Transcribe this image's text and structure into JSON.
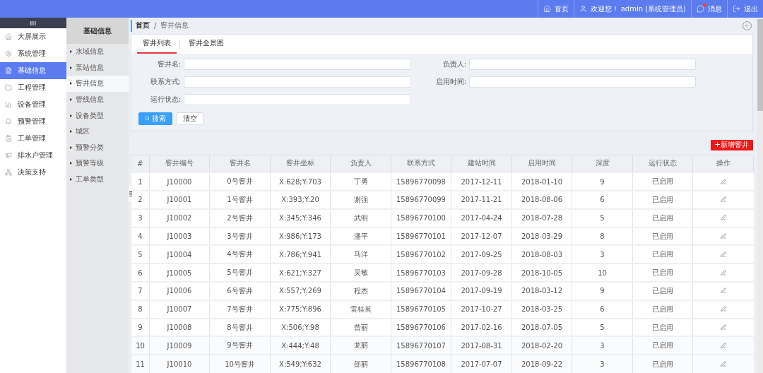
{
  "top_bar": {
    "links": [
      {
        "kind": "home",
        "label": "首页"
      },
      {
        "kind": "user",
        "label": "欢迎您！ admin (系统管理员)"
      },
      {
        "kind": "message",
        "label": "消息",
        "unread": true
      },
      {
        "kind": "logout",
        "label": "退出"
      }
    ]
  },
  "sidebar": {
    "items": [
      {
        "label": "大屏展示",
        "selected": false
      },
      {
        "label": "系统管理",
        "selected": false
      },
      {
        "label": "基础信息",
        "selected": true
      },
      {
        "label": "工程管理",
        "selected": false
      },
      {
        "label": "设备管理",
        "selected": false
      },
      {
        "label": "预警管理",
        "selected": false
      },
      {
        "label": "工单管理",
        "selected": false
      },
      {
        "label": "排水户管理",
        "selected": false
      },
      {
        "label": "决策支持",
        "selected": false
      }
    ]
  },
  "submenu": {
    "title": "基础信息",
    "items": [
      {
        "label": "水域信息",
        "selected": false
      },
      {
        "label": "泵站信息",
        "selected": false
      },
      {
        "label": "窨井信息",
        "selected": true
      },
      {
        "label": "管线信息",
        "selected": false
      },
      {
        "label": "设备类型",
        "selected": false
      },
      {
        "label": "城区",
        "selected": false
      },
      {
        "label": "预警分类",
        "selected": false
      },
      {
        "label": "预警等级",
        "selected": false
      },
      {
        "label": "工单类型",
        "selected": false
      }
    ]
  },
  "breadcrumb": {
    "items": [
      "首页",
      "窨井信息"
    ],
    "separator": "/"
  },
  "tabs": [
    {
      "label": "窨井列表",
      "selected": true
    },
    {
      "label": "窨井全景图",
      "selected": false
    }
  ],
  "filters": [
    {
      "label": "窨井名:"
    },
    {
      "label": "负责人:"
    },
    {
      "label": "联系方式:"
    },
    {
      "label": "启用时间:"
    },
    {
      "label": "运行状态:"
    }
  ],
  "buttons": {
    "search": "搜索",
    "clear": "清空",
    "add": "+新增窨井"
  },
  "table": {
    "columns": [
      "#",
      "窨井编号",
      "窨井名",
      "窨井坐标",
      "负责人",
      "联系方式",
      "建站时间",
      "启用时间",
      "深度",
      "运行状态",
      "操作"
    ],
    "rows": [
      [
        "1",
        "J10000",
        "0号窨井",
        "X:628;Y:703",
        "丁勇",
        "15896770098",
        "2017-12-11",
        "2018-01-10",
        "9",
        "已启用"
      ],
      [
        "2",
        "J10001",
        "1号窨井",
        "X:393;Y:20",
        "谢强",
        "15896770099",
        "2017-11-21",
        "2018-08-06",
        "6",
        "已启用"
      ],
      [
        "3",
        "J10002",
        "2号窨井",
        "X:345;Y:346",
        "武明",
        "15896770100",
        "2017-04-24",
        "2018-07-28",
        "5",
        "已启用"
      ],
      [
        "4",
        "J10003",
        "3号窨井",
        "X:986;Y:173",
        "潘平",
        "15896770101",
        "2017-12-07",
        "2018-03-29",
        "8",
        "已启用"
      ],
      [
        "5",
        "J10004",
        "4号窨井",
        "X:786;Y:941",
        "马洋",
        "15896770102",
        "2017-09-25",
        "2018-08-03",
        "3",
        "已启用"
      ],
      [
        "6",
        "J10005",
        "5号窨井",
        "X:621;Y:327",
        "吴敏",
        "15896770103",
        "2017-09-28",
        "2018-10-05",
        "10",
        "已启用"
      ],
      [
        "7",
        "J10006",
        "6号窨井",
        "X:557;Y:269",
        "程杰",
        "15896770104",
        "2017-09-19",
        "2018-03-12",
        "9",
        "已启用"
      ],
      [
        "8",
        "J10007",
        "7号窨井",
        "X:775;Y:896",
        "雷桂英",
        "15896770105",
        "2017-10-27",
        "2018-03-25",
        "6",
        "已启用"
      ],
      [
        "9",
        "J10008",
        "8号窨井",
        "X:506;Y:98",
        "曾丽",
        "15896770106",
        "2017-02-16",
        "2018-07-05",
        "5",
        "已启用"
      ],
      [
        "10",
        "J10009",
        "9号窨井",
        "X:444;Y:48",
        "龙丽",
        "15896770107",
        "2017-08-31",
        "2018-02-20",
        "3",
        "已启用"
      ],
      [
        "11",
        "J10010",
        "10号窨井",
        "X:549;Y:632",
        "邵丽",
        "15896770108",
        "2017-07-07",
        "2018-09-22",
        "3",
        "已启用"
      ]
    ]
  }
}
